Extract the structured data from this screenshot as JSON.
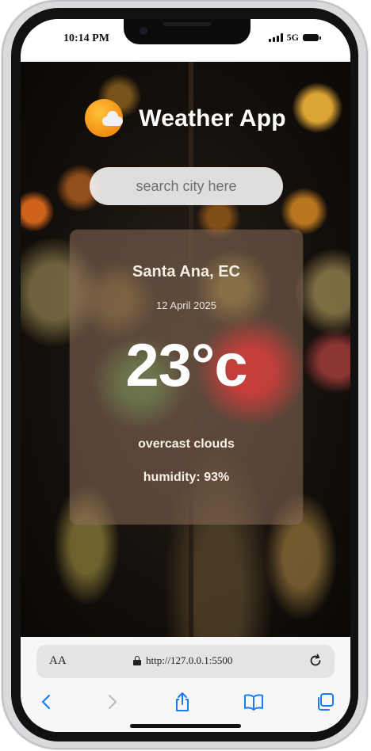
{
  "status_bar": {
    "time": "10:14 PM",
    "network": "5G"
  },
  "app": {
    "title": "Weather App",
    "icon": "sun-cloud-icon",
    "search": {
      "placeholder": "search city here",
      "value": ""
    },
    "weather": {
      "city": "Santa Ana, EC",
      "date": "12 April 2025",
      "temperature": "23°c",
      "description": "overcast clouds",
      "humidity": "humidity: 93%"
    }
  },
  "browser": {
    "text_size_label": "AA",
    "url": "http://127.0.0.1:5500",
    "icons": [
      "lock-icon",
      "reload-icon",
      "back-icon",
      "forward-icon",
      "share-icon",
      "bookmarks-icon",
      "tabs-icon"
    ],
    "accent": "#1a7cf5"
  }
}
